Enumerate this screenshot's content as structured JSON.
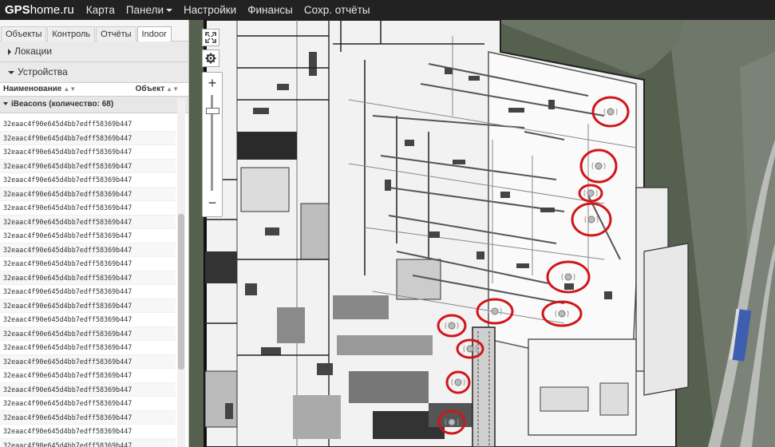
{
  "header": {
    "brand_bold": "GPS",
    "brand_light": "home.ru",
    "nav": [
      {
        "label": "Карта"
      },
      {
        "label": "Панели"
      },
      {
        "label": "Настройки"
      },
      {
        "label": "Финансы"
      },
      {
        "label": "Сохр. отчёты"
      }
    ]
  },
  "sidebar": {
    "tabs": [
      "Объекты",
      "Контроль",
      "Отчёты",
      "Indoor"
    ],
    "active_tab": "Indoor",
    "locations_label": "Локации",
    "devices_label": "Устройства",
    "columns": {
      "name": "Наименование",
      "object": "Объект"
    },
    "group_label": "iBeacons (количество: 68)",
    "rows": [
      "32eaac4f90e645d4bb7edff58369b447",
      "32eaac4f90e645d4bb7edff58369b447",
      "32eaac4f90e645d4bb7edff58369b447",
      "32eaac4f90e645d4bb7edff58369b447",
      "32eaac4f90e645d4bb7edff58369b447",
      "32eaac4f90e645d4bb7edff58369b447",
      "32eaac4f90e645d4bb7edff58369b447",
      "32eaac4f90e645d4bb7edff58369b447",
      "32eaac4f90e645d4bb7edff58369b447",
      "32eaac4f90e645d4bb7edff58369b447",
      "32eaac4f90e645d4bb7edff58369b447",
      "32eaac4f90e645d4bb7edff58369b447",
      "32eaac4f90e645d4bb7edff58369b447",
      "32eaac4f90e645d4bb7edff58369b447",
      "32eaac4f90e645d4bb7edff58369b447",
      "32eaac4f90e645d4bb7edff58369b447",
      "32eaac4f90e645d4bb7edff58369b447",
      "32eaac4f90e645d4bb7edff58369b447",
      "32eaac4f90e645d4bb7edff58369b447",
      "32eaac4f90e645d4bb7edff58369b447",
      "32eaac4f90e645d4bb7edff58369b447",
      "32eaac4f90e645d4bb7edff58369b447",
      "32eaac4f90e645d4bb7edff58369b447",
      "32eaac4f90e645d4bb7edff58369b447"
    ]
  },
  "map": {
    "tools": [
      "fullscreen-icon",
      "gear-icon"
    ],
    "zoom_in": "+",
    "zoom_out": "−",
    "beacon_color": "#d0161b"
  }
}
